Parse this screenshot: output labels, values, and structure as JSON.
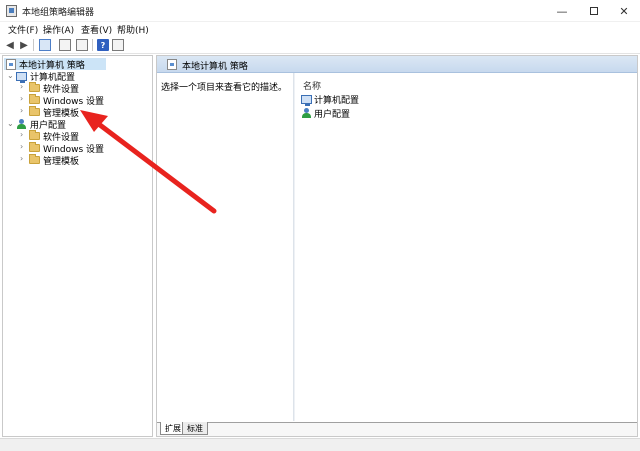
{
  "window": {
    "title": "本地组策略编辑器"
  },
  "menu": {
    "items": [
      "文件(F)",
      "操作(A)",
      "查看(V)",
      "帮助(H)"
    ]
  },
  "toolbar": {
    "icons": [
      "back-icon",
      "forward-icon",
      "console-tree-icon",
      "properties-icon",
      "export-icon",
      "help-icon",
      "view-icon"
    ]
  },
  "tree": {
    "root": "本地计算机 策略",
    "computer_config": "计算机配置",
    "computer_children": [
      "软件设置",
      "Windows 设置",
      "管理模板"
    ],
    "user_config": "用户配置",
    "user_children": [
      "软件设置",
      "Windows 设置",
      "管理模板"
    ]
  },
  "right_pane": {
    "header_title": "本地计算机 策略",
    "description": "选择一个项目来查看它的描述。",
    "column_header": "名称",
    "items": [
      "计算机配置",
      "用户配置"
    ]
  },
  "tabs": [
    "扩展",
    "标准"
  ],
  "colors": {
    "selection": "#cce4f7",
    "header": "#c7d9ee",
    "arrow": "#e8231e"
  }
}
